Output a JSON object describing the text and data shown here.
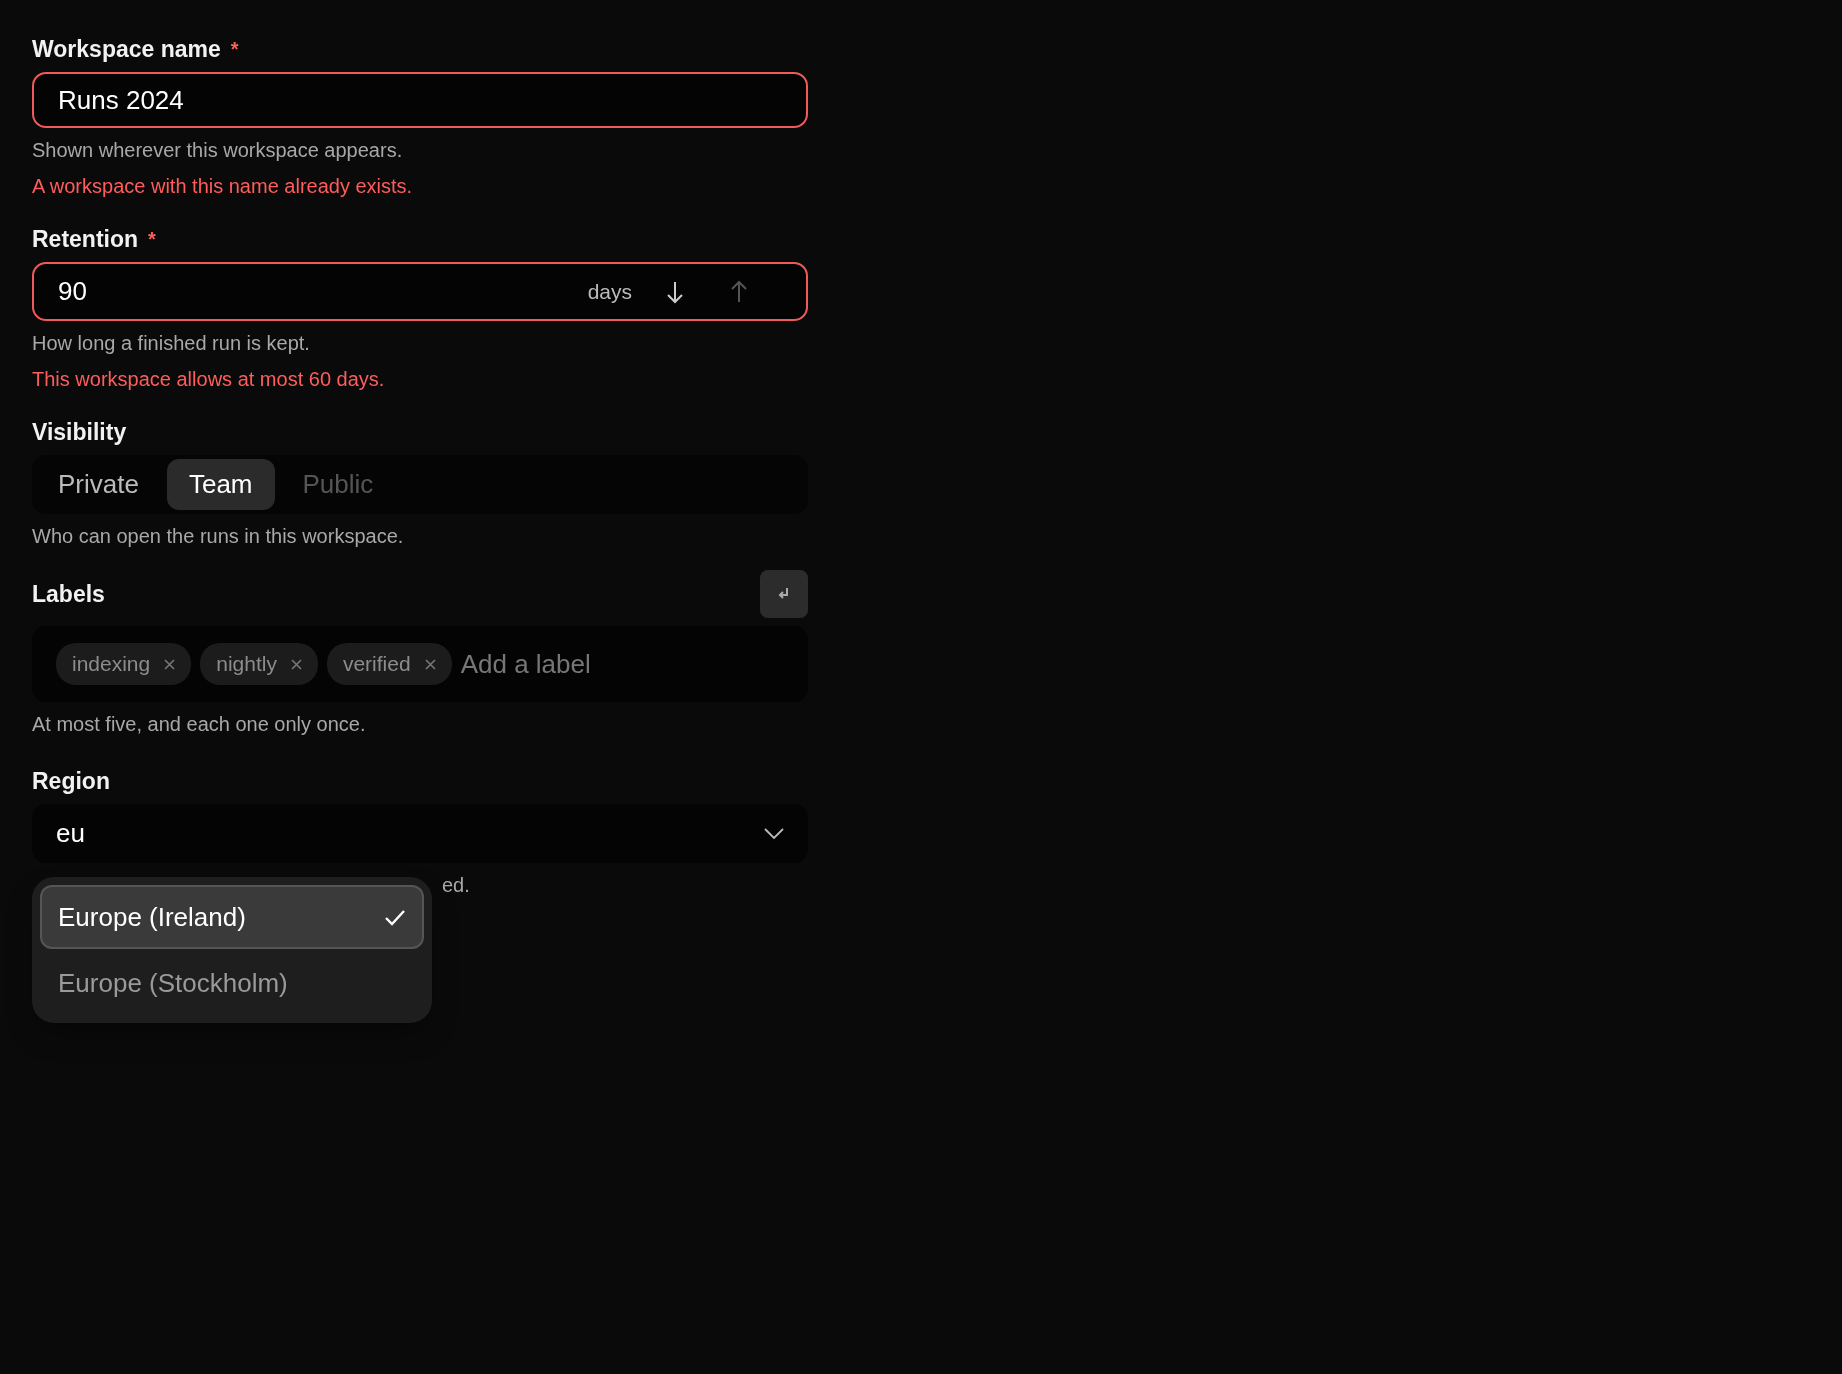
{
  "workspace_name": {
    "label": "Workspace name",
    "required_mark": "*",
    "value": "Runs 2024",
    "hint": "Shown wherever this workspace appears.",
    "error": "A workspace with this name already exists."
  },
  "retention": {
    "label": "Retention",
    "required_mark": "*",
    "value": "90",
    "unit": "days",
    "decrease": {
      "disabled": false
    },
    "increase": {
      "disabled": true
    },
    "hint": "How long a finished run is kept.",
    "error": "This workspace allows at most 60 days."
  },
  "visibility": {
    "label": "Visibility",
    "options": [
      {
        "label": "Private",
        "selected": false,
        "disabled": false
      },
      {
        "label": "Team",
        "selected": true,
        "disabled": false
      },
      {
        "label": "Public",
        "selected": false,
        "disabled": true
      }
    ],
    "hint": "Who can open the runs in this workspace."
  },
  "labels": {
    "label": "Labels",
    "tags": [
      "indexing",
      "nightly",
      "verified"
    ],
    "placeholder": "Add a label",
    "hint": "At most five, and each one only once."
  },
  "region": {
    "label": "Region",
    "value": "eu",
    "expanded": true,
    "hint_visible": "ed.",
    "options": [
      {
        "label": "Europe (Ireland)",
        "selected": true
      },
      {
        "label": "Europe (Stockholm)",
        "selected": false
      }
    ]
  }
}
